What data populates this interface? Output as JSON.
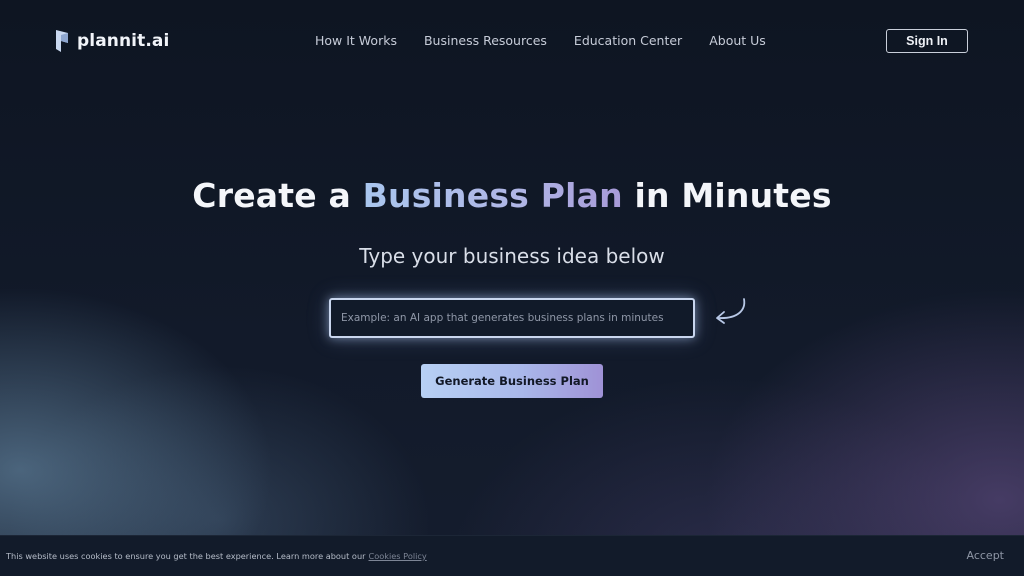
{
  "brand": {
    "name": "plannit.ai",
    "logo_icon": "plannit-logo-icon",
    "accent": "#a9b8ea"
  },
  "nav": {
    "items": [
      {
        "label": "How It Works"
      },
      {
        "label": "Business Resources"
      },
      {
        "label": "Education Center"
      },
      {
        "label": "About Us"
      }
    ],
    "signin_label": "Sign In"
  },
  "hero": {
    "title_prefix": "Create a",
    "title_accent": "Business Plan",
    "title_suffix": "in Minutes",
    "subtitle": "Type your business idea below",
    "input_value": "",
    "input_placeholder": "Example: an AI app that generates business plans in minutes",
    "arrow_icon": "curved-arrow-left-icon",
    "generate_label": "Generate Business Plan",
    "button_gradient": [
      "#b7d0f4",
      "#9f92d6"
    ]
  },
  "cookie": {
    "text": "This website uses cookies to ensure you get the best experience. Learn more about our",
    "link_label": "Cookies Policy",
    "accept_label": "Accept"
  }
}
